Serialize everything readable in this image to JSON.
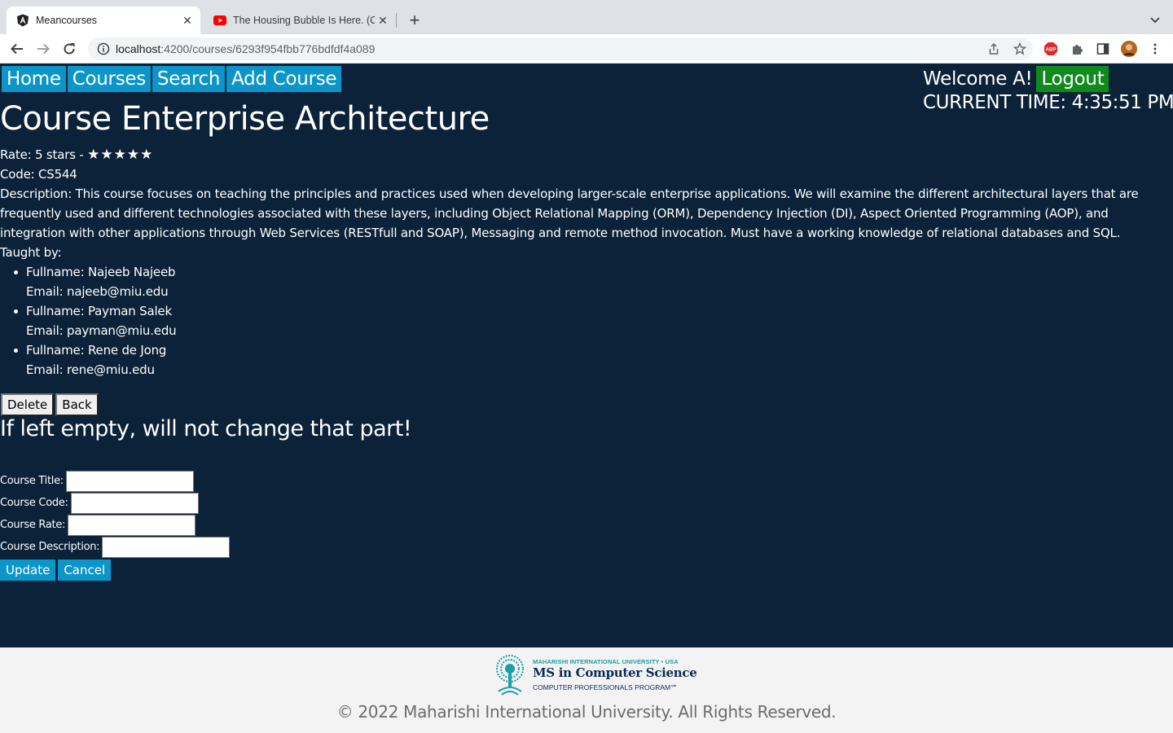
{
  "browser": {
    "tabs": [
      {
        "title": "Meancourses",
        "active": true,
        "icon": "angular-icon"
      },
      {
        "title": "The Housing Bubble Is Here. (C",
        "active": false,
        "icon": "youtube-icon"
      }
    ],
    "url_host": "localhost",
    "url_rest": ":4200/courses/6293f954fbb776bdfdf4a089"
  },
  "nav": {
    "home": "Home",
    "courses": "Courses",
    "search": "Search",
    "add_course": "Add Course"
  },
  "user": {
    "welcome": "Welcome A!",
    "logout": "Logout",
    "current_time": "CURRENT TIME: 4:35:51 PM"
  },
  "course": {
    "title": "Course Enterprise Architecture",
    "rate_label": "Rate: 5 stars -",
    "stars": "★★★★★",
    "rating": 5,
    "code_line": "Code: CS544",
    "description_line": "Description: This course focuses on teaching the principles and practices used when developing larger-scale enterprise applications. We will examine the different architectural layers that are frequently used and different technologies associated with these layers, including Object Relational Mapping (ORM), Dependency Injection (DI), Aspect Oriented Programming (AOP), and integration with other applications through Web Services (RESTfull and SOAP), Messaging and remote method invocation. Must have a working knowledge of relational databases and SQL.",
    "taught_by": "Taught by:",
    "teachers": [
      {
        "fullname": "Fullname: Najeeb Najeeb",
        "email": "Email: najeeb@miu.edu"
      },
      {
        "fullname": "Fullname: Payman Salek",
        "email": "Email: payman@miu.edu"
      },
      {
        "fullname": "Fullname: Rene de Jong",
        "email": "Email: rene@miu.edu"
      }
    ]
  },
  "buttons": {
    "delete": "Delete",
    "back": "Back"
  },
  "form": {
    "note": "If left empty, will not change that part!",
    "title_label": "Course Title:",
    "code_label": "Course Code:",
    "rate_label": "Course Rate:",
    "description_label": "Course Description:",
    "title_value": "",
    "code_value": "",
    "rate_value": "",
    "description_value": "",
    "update": "Update",
    "cancel": "Cancel"
  },
  "footer": {
    "logo_top": "MAHARISHI INTERNATIONAL UNIVERSITY • USA",
    "logo_main": "MS in Computer Science",
    "logo_sub": "COMPUTER PROFESSIONALS PROGRAM℠",
    "copyright": "© 2022 Maharishi International University. All Rights Reserved."
  },
  "colors": {
    "page_bg": "#0b2239",
    "nav_button": "#0b95c9",
    "logout_button": "#108a1d",
    "footer_bg": "#f3f3f3"
  }
}
